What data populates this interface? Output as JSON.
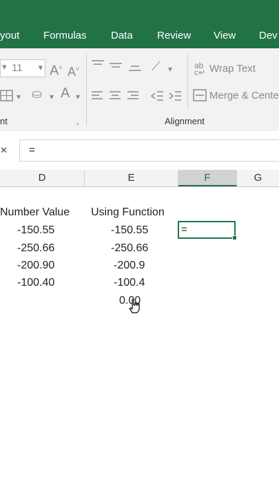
{
  "tabs": [
    "yout",
    "Formulas",
    "Data",
    "Review",
    "View",
    "Dev"
  ],
  "ribbon": {
    "font_size": "11",
    "wrap_text": "Wrap Text",
    "merge_center": "Merge & Cente",
    "group_font_partial": "nt",
    "group_alignment": "Alignment"
  },
  "formula_bar": {
    "content": "="
  },
  "columns": [
    "D",
    "E",
    "F",
    "G"
  ],
  "sheet": {
    "header_d": "Number Value",
    "header_e": "Using Function",
    "col_d": [
      "-150.55",
      "-250.66",
      "-200.90",
      "-100.40"
    ],
    "col_e": [
      "-150.55",
      "-250.66",
      "-200.9",
      "-100.4",
      "0.00"
    ],
    "active_cell_content": "="
  },
  "colors": {
    "excel_green": "#217346",
    "ribbon_bg": "#f3f2f1"
  }
}
